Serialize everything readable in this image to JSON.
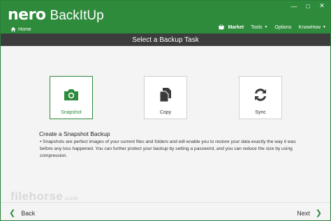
{
  "app": {
    "brand": "nero",
    "product": "BackItUp",
    "home_label": "Home"
  },
  "window_controls": {
    "minimize": "—",
    "restore": "□",
    "close": "✕"
  },
  "menu": {
    "market": "Market",
    "tools": "Tools",
    "options": "Options",
    "knowhow": "KnowHow"
  },
  "title": "Select a Backup Task",
  "tasks": [
    {
      "label": "Snapshot",
      "icon": "camera-icon",
      "selected": true
    },
    {
      "label": "Copy",
      "icon": "copy-icon",
      "selected": false
    },
    {
      "label": "Sync",
      "icon": "sync-icon",
      "selected": false
    }
  ],
  "description": {
    "title": "Create a Snapshot Backup",
    "body": "• Snapshots are perfect images of your current files and folders and will enable you to restore your data exactly the way it was before any loss happened. You can further protect your backup by setting a password, and you can reduce the size by using compression."
  },
  "watermark": {
    "text": "filehorse",
    "suffix": ".com"
  },
  "footer": {
    "back": "Back",
    "next": "Next"
  },
  "colors": {
    "brand_green": "#2e8b3c",
    "title_bar": "#3c3c3c",
    "background": "#f4f4f4"
  }
}
